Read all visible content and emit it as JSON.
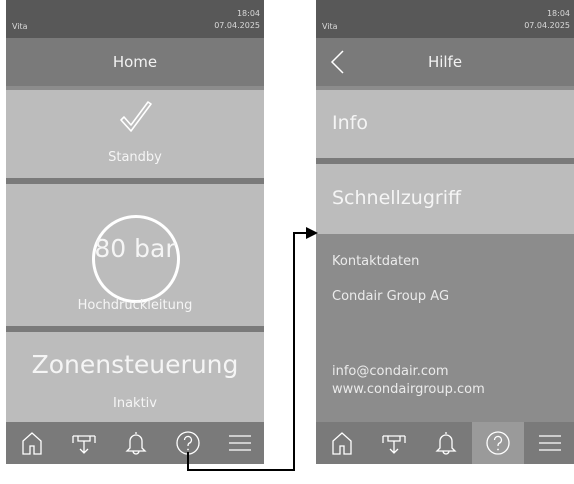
{
  "left": {
    "status": {
      "device": "Vita",
      "time": "18:04",
      "date": "07.04.2025"
    },
    "title": "Home",
    "standby": {
      "label": "Standby",
      "icon": "checkmark-icon"
    },
    "pressure": {
      "value": "80 bar",
      "label": "Hochdruckleitung"
    },
    "zone": {
      "title": "Zonensteuerung",
      "status": "Inaktiv"
    },
    "nav": [
      "home-icon",
      "humidifier-icon",
      "bell-icon",
      "help-icon",
      "menu-icon"
    ]
  },
  "right": {
    "status": {
      "device": "Vita",
      "time": "18:04",
      "date": "07.04.2025"
    },
    "title": "Hilfe",
    "menu": [
      {
        "label": "Info"
      },
      {
        "label": "Schnellzugriff"
      }
    ],
    "contact": {
      "heading": "Kontaktdaten",
      "company": "Condair Group AG",
      "email": "info@condair.com",
      "web": "www.condairgroup.com"
    },
    "nav": [
      "home-icon",
      "humidifier-icon",
      "bell-icon",
      "help-icon",
      "menu-icon"
    ],
    "active_nav": "help-icon"
  },
  "colors": {
    "statusbar": "#585858",
    "titlebar": "#7a7a7a",
    "tile": "#bcbcbc",
    "background": "#8c8c8c",
    "arrow": "#000000"
  }
}
